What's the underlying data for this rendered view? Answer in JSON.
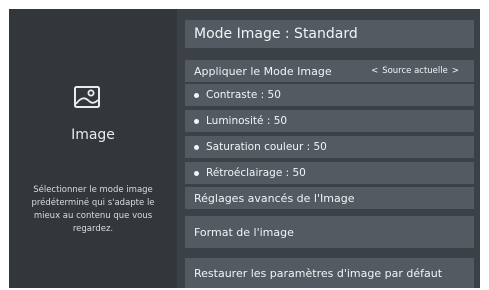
{
  "left_panel": {
    "icon": "image-icon",
    "title": "Image",
    "description": "Sélectionner le mode image prédéterminé qui s'adapte le mieux au contenu que vous regardez."
  },
  "menu": {
    "header": "Mode Image : Standard",
    "apply_mode": {
      "label": "Appliquer le Mode Image",
      "left_arrow": "<",
      "value": "Source actuelle",
      "right_arrow": ">"
    },
    "contrast": "Contraste : 50",
    "brightness": "Luminosité : 50",
    "saturation": "Saturation couleur : 50",
    "backlight": "Rétroéclairage : 50",
    "advanced": "Réglages avancés de l'Image",
    "format": "Format de l'image",
    "restore": "Restaurer les paramètres d'image par défaut"
  },
  "colors": {
    "frame_bg": "#2e3338",
    "left_panel_bg": "#32373c",
    "right_panel_bg": "#3c4148",
    "row_bg": "#545a61",
    "text": "#f2f4f6"
  }
}
